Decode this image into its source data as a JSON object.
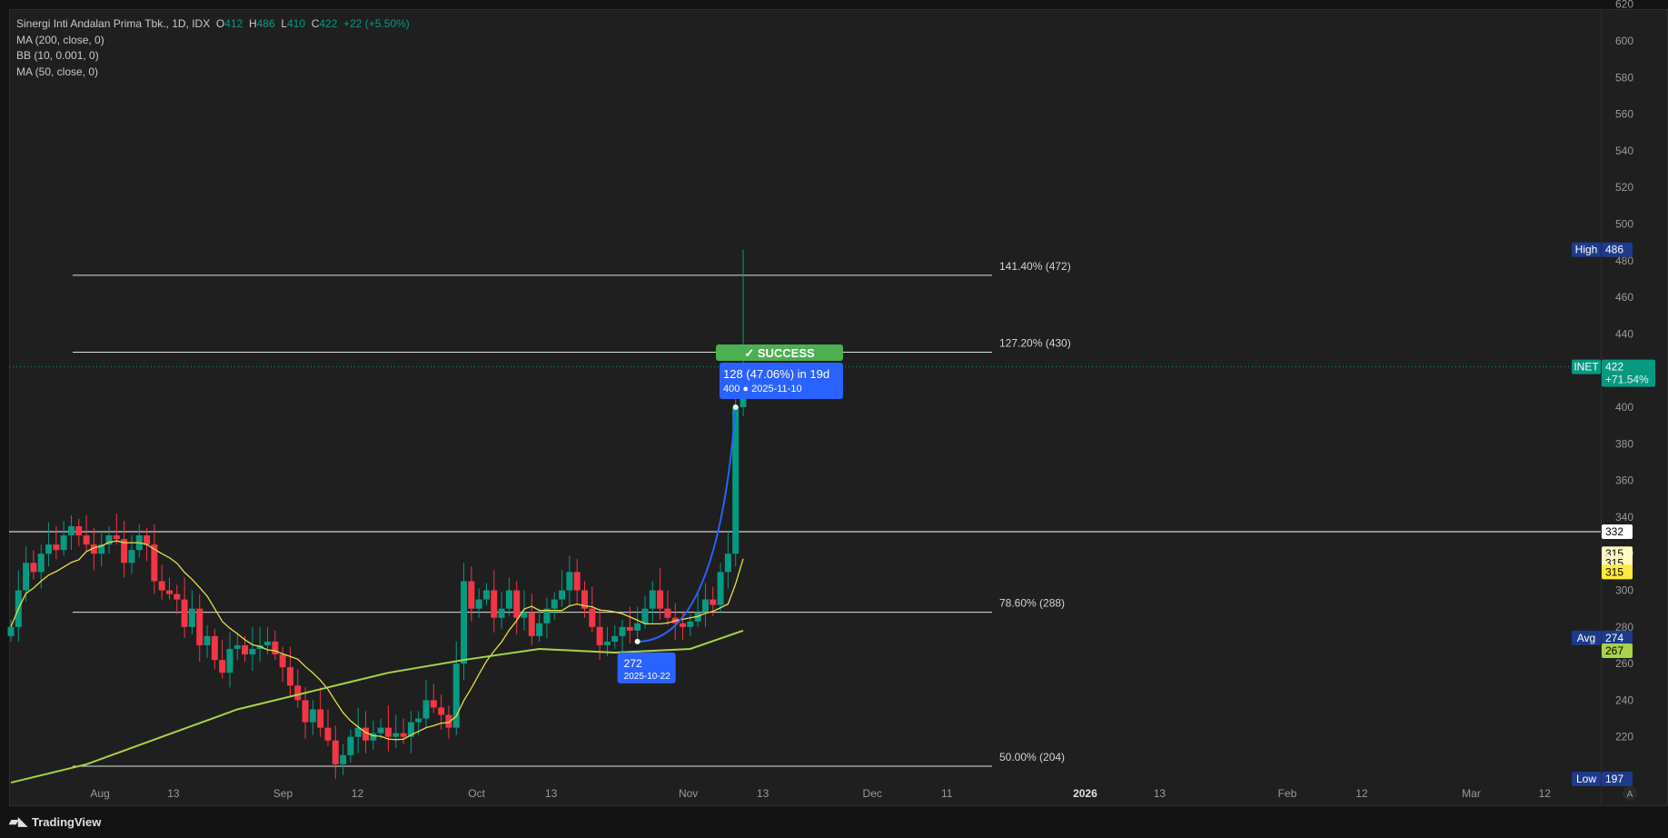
{
  "legend": {
    "symbol": "Sinergi Inti Andalan Prima Tbk., 1D, IDX",
    "o_label": "O",
    "o": "412",
    "h_label": "H",
    "h": "486",
    "l_label": "L",
    "l": "410",
    "c_label": "C",
    "c": "422",
    "change": "+22 (+5.50%)",
    "indicators": [
      "MA (200, close, 0)",
      "BB (10, 0.001, 0)",
      "MA (50, close, 0)"
    ]
  },
  "colors": {
    "up": "#089981",
    "down": "#f23645",
    "ma_short": "#e5e04a",
    "ma_long": "#a8d34a",
    "projection": "#2962ff",
    "success": "#4caf50",
    "badge_blue": "#1e3a8a"
  },
  "chart_data": {
    "type": "candlestick",
    "ylim": [
      190,
      620
    ],
    "yticks": [
      220,
      240,
      260,
      280,
      300,
      320,
      340,
      360,
      380,
      400,
      420,
      440,
      460,
      480,
      500,
      520,
      540,
      560,
      580,
      600,
      620
    ],
    "closes": [
      280,
      300,
      315,
      310,
      320,
      325,
      322,
      330,
      335,
      330,
      325,
      320,
      325,
      330,
      328,
      315,
      322,
      330,
      325,
      305,
      300,
      298,
      295,
      280,
      290,
      270,
      275,
      262,
      255,
      268,
      270,
      265,
      268,
      270,
      272,
      265,
      258,
      248,
      240,
      228,
      235,
      225,
      218,
      205,
      210,
      220,
      225,
      218,
      222,
      225,
      220,
      222,
      220,
      228,
      230,
      240,
      236,
      232,
      225,
      260,
      305,
      290,
      295,
      300,
      285,
      290,
      300,
      285,
      288,
      275,
      282,
      290,
      295,
      300,
      310,
      300,
      290,
      280,
      270,
      272,
      275,
      280,
      278,
      282,
      290,
      300,
      290,
      285,
      282,
      280,
      283,
      288,
      295,
      292,
      310,
      320,
      400,
      422
    ],
    "ma50": [
      [
        0,
        195
      ],
      [
        10,
        205
      ],
      [
        20,
        220
      ],
      [
        30,
        235
      ],
      [
        40,
        245
      ],
      [
        50,
        255
      ],
      [
        60,
        262
      ],
      [
        70,
        268
      ],
      [
        80,
        266
      ],
      [
        90,
        268
      ],
      [
        97,
        278
      ]
    ],
    "fib_levels": [
      {
        "label": "141.40% (472)",
        "price": 472
      },
      {
        "label": "127.20% (430)",
        "price": 430
      },
      {
        "label": "78.60% (288)",
        "price": 288
      },
      {
        "label": "50.00% (204)",
        "price": 204
      }
    ],
    "hline": 332,
    "current_price": 422,
    "projection": {
      "start_price": 272,
      "start_date": "2025-10-22",
      "end_price": 400,
      "end_date": "2025-11-10",
      "summary": "128 (47.06%) in 19d",
      "status": "SUCCESS"
    },
    "xticks": [
      "Aug",
      "13",
      "Sep",
      "12",
      "Oct",
      "13",
      "Nov",
      "13",
      "Dec",
      "11",
      "2026",
      "13",
      "Feb",
      "12",
      "Mar",
      "12"
    ],
    "axis_badges": [
      {
        "tag": "High",
        "value": "486",
        "price": 486
      },
      {
        "tag": "INET",
        "value": "422",
        "sub": "+71.54%",
        "price": 422
      },
      {
        "value": "332",
        "price": 332
      },
      {
        "value": "315",
        "price": 320
      },
      {
        "value": "315",
        "price": 315
      },
      {
        "value": "315",
        "price": 310
      },
      {
        "tag": "Avg",
        "value": "274",
        "price": 274
      },
      {
        "value": "267",
        "price": 267
      },
      {
        "tag": "Low",
        "value": "197",
        "price": 197
      }
    ]
  },
  "footer": {
    "brand": "TradingView"
  },
  "axis_mode": "A"
}
